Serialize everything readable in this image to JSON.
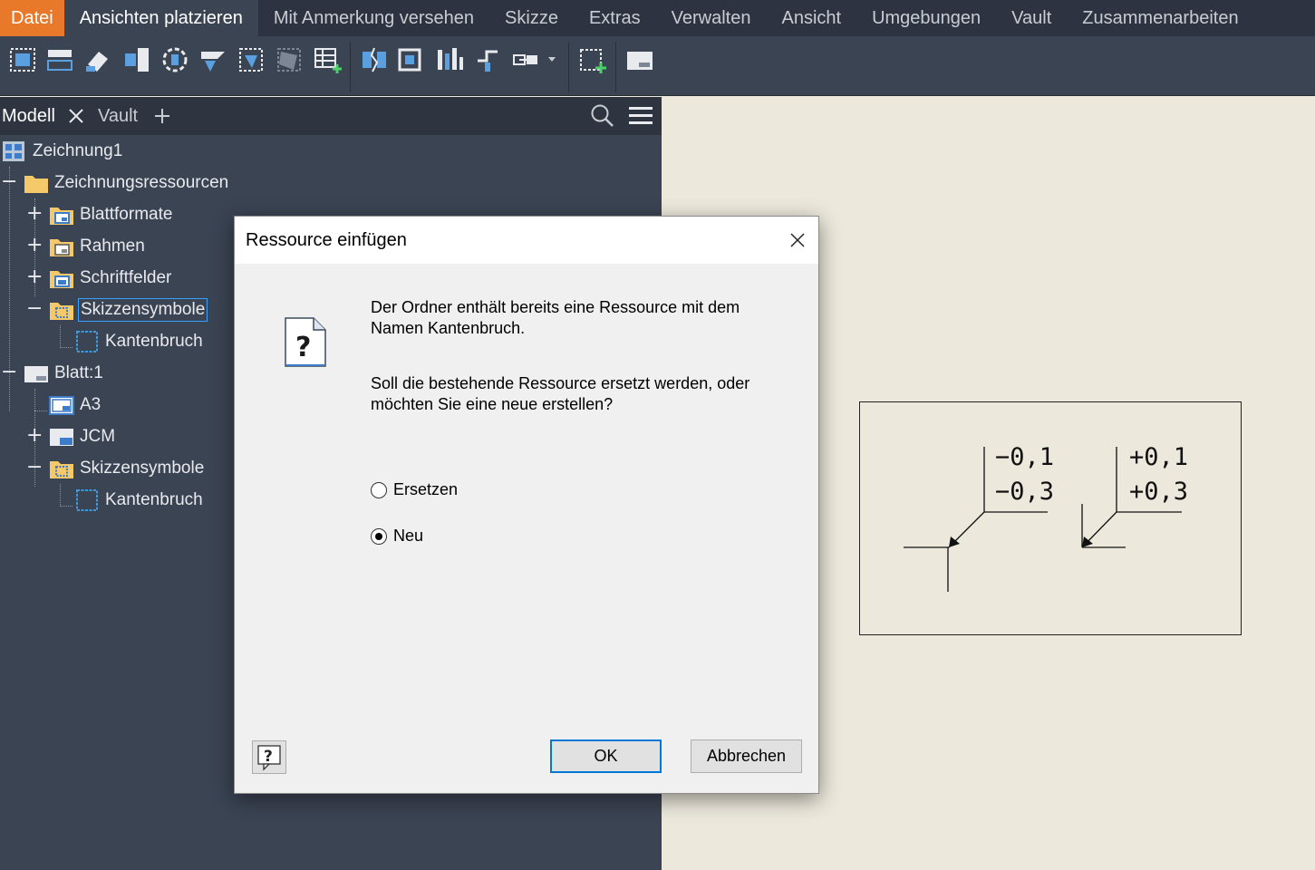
{
  "menubar": {
    "items": [
      {
        "label": "Datei"
      },
      {
        "label": "Ansichten platzieren"
      },
      {
        "label": "Mit Anmerkung versehen"
      },
      {
        "label": "Skizze"
      },
      {
        "label": "Extras"
      },
      {
        "label": "Verwalten"
      },
      {
        "label": "Ansicht"
      },
      {
        "label": "Umgebungen"
      },
      {
        "label": "Vault"
      },
      {
        "label": "Zusammenarbeiten"
      }
    ],
    "active_index": 1
  },
  "browser": {
    "tabs": [
      {
        "label": "Modell"
      },
      {
        "label": "Vault"
      }
    ],
    "add_tab_icon": "plus-icon",
    "tree": [
      {
        "label": "Zeichnung1"
      },
      {
        "label": "Zeichnungsressourcen"
      },
      {
        "label": "Blattformate"
      },
      {
        "label": "Rahmen"
      },
      {
        "label": "Schriftfelder"
      },
      {
        "label": "Skizzensymbole"
      },
      {
        "label": "Kantenbruch"
      },
      {
        "label": "Blatt:1"
      },
      {
        "label": "A3"
      },
      {
        "label": "JCM"
      },
      {
        "label": "Skizzensymbole"
      },
      {
        "label": "Kantenbruch"
      }
    ]
  },
  "sketch": {
    "left_upper": "−0,1",
    "left_lower": "−0,3",
    "right_upper": "+0,1",
    "right_lower": "+0,3"
  },
  "dialog": {
    "title": "Ressource einfügen",
    "message_line1": "Der Ordner enthält bereits eine Ressource mit dem",
    "message_line2": "Namen Kantenbruch.",
    "question_line1": "Soll die bestehende Ressource ersetzt werden, oder",
    "question_line2": "möchten Sie eine neue erstellen?",
    "options": [
      {
        "label": "Ersetzen",
        "selected": false
      },
      {
        "label": "Neu",
        "selected": true
      }
    ],
    "ok_label": "OK",
    "cancel_label": "Abbrechen"
  },
  "colors": {
    "menubar_bg": "#2d3340",
    "file_tab": "#e8782a",
    "panel_bg": "#3b4453",
    "canvas_bg": "#ece9dc",
    "selection": "#3aa0ff"
  }
}
